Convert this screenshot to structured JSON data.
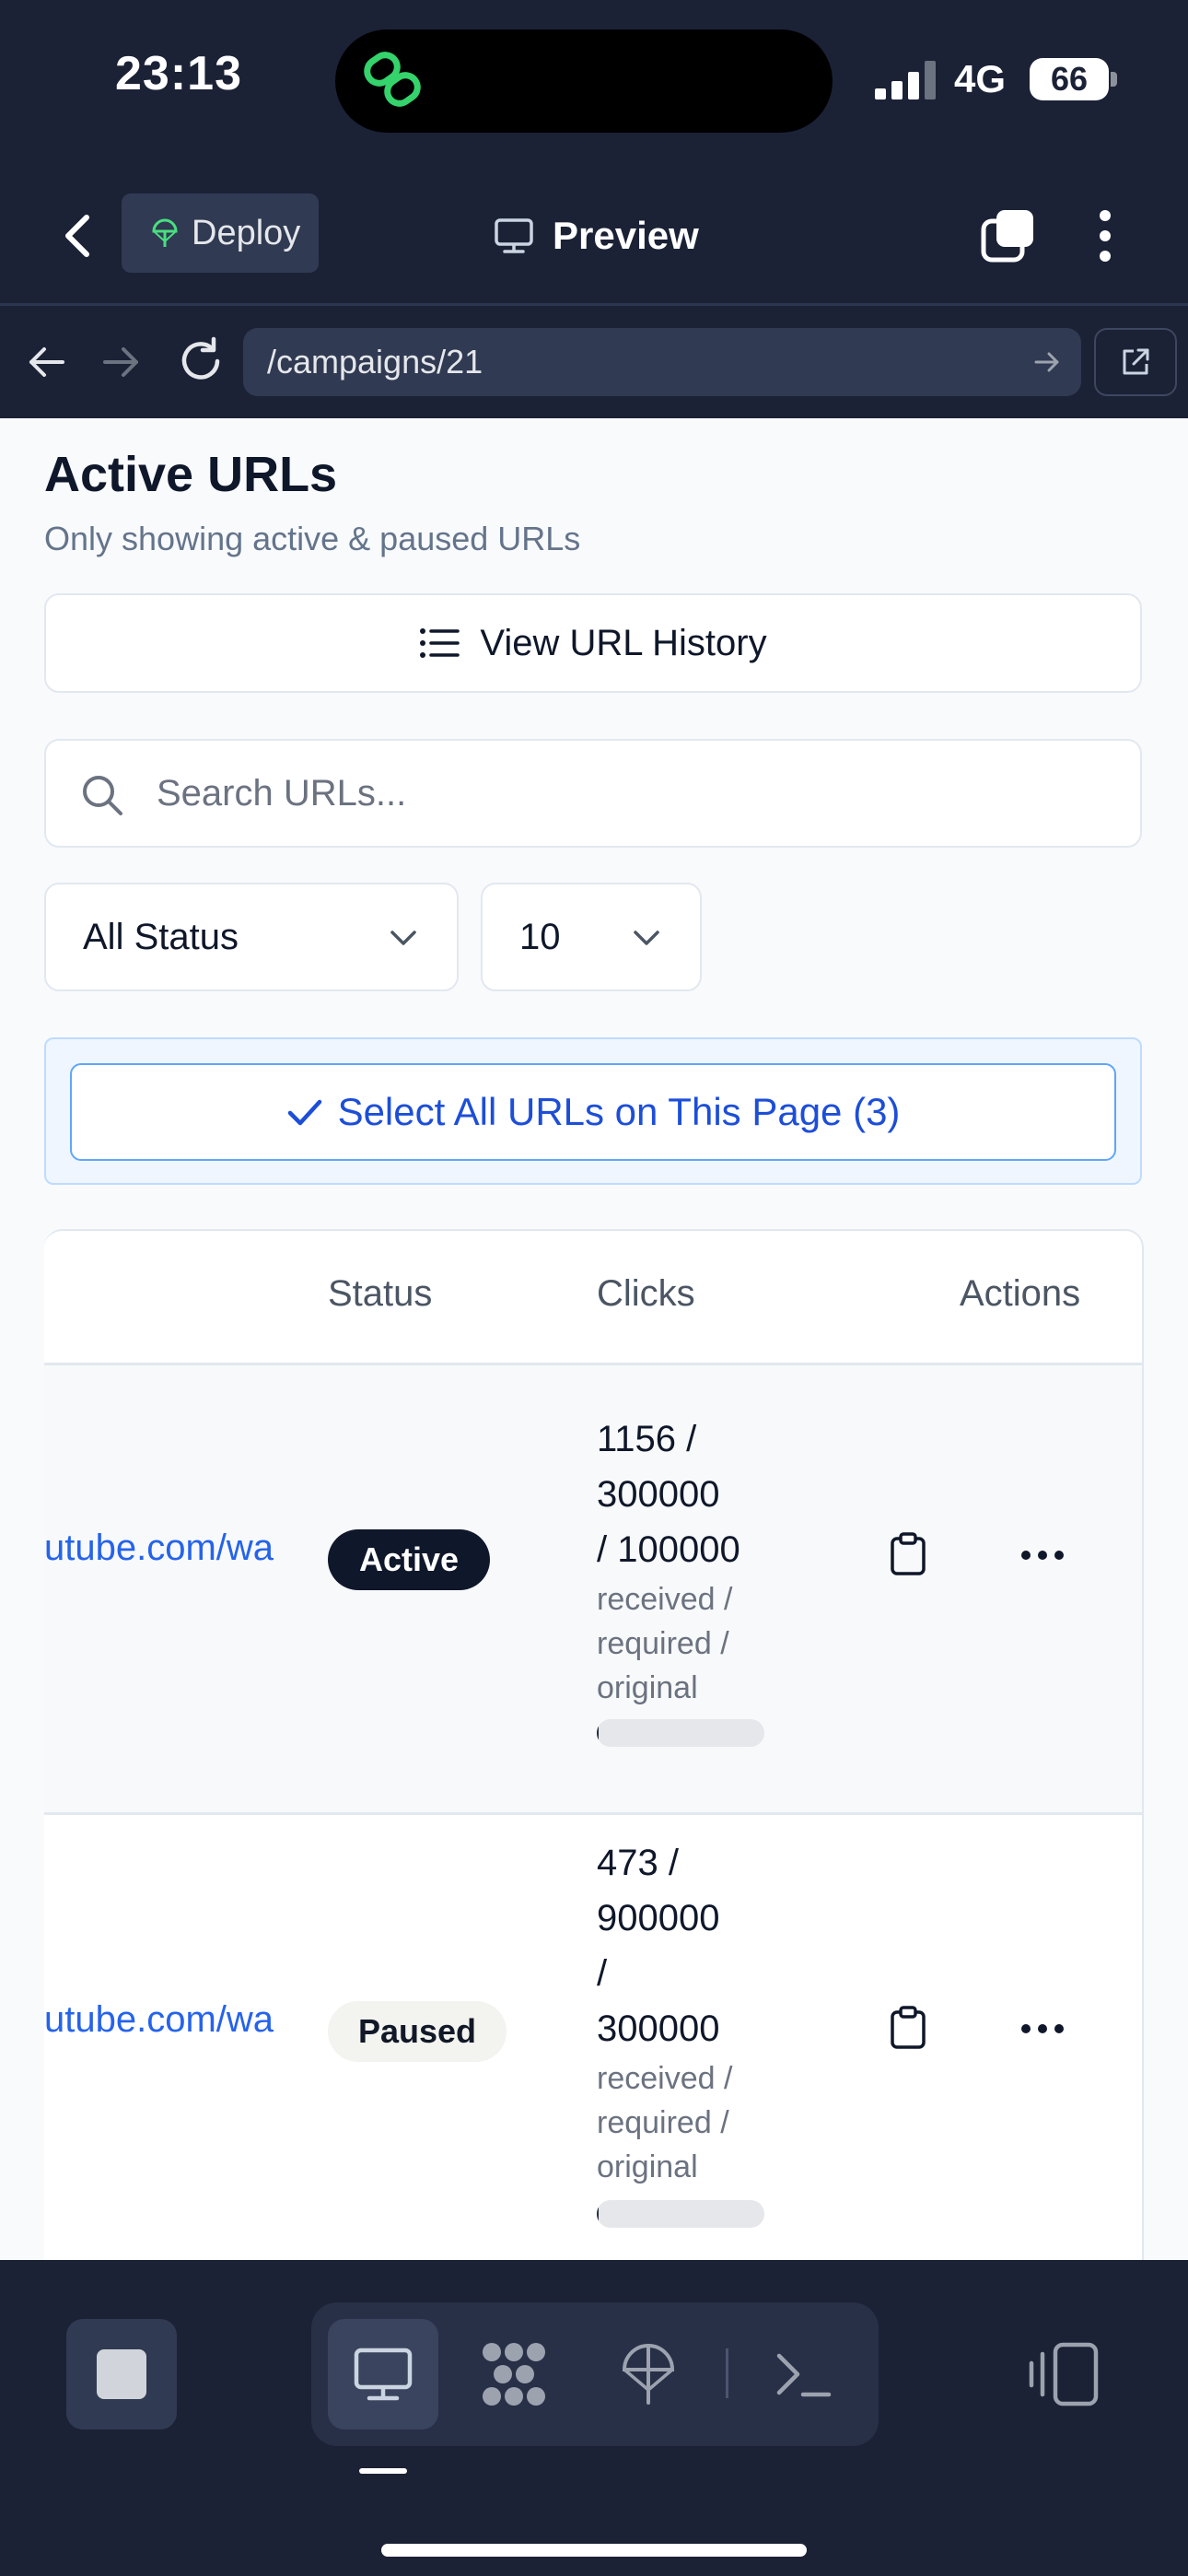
{
  "status_bar": {
    "time": "23:13",
    "network": "4G",
    "battery": "66",
    "icons": [
      "chat-app-icon",
      "signal-bars-icon",
      "battery-icon"
    ]
  },
  "app_header": {
    "deploy_label": "Deploy",
    "preview_label": "Preview",
    "icons": [
      "back-icon",
      "deploy-icon",
      "monitor-icon",
      "tabs-icon",
      "more-vertical-icon"
    ]
  },
  "url_bar": {
    "url": "/campaigns/21",
    "icons": [
      "back-arrow-icon",
      "forward-arrow-icon",
      "reload-icon",
      "go-arrow-icon",
      "external-link-icon"
    ]
  },
  "page": {
    "title": "Active URLs",
    "subtitle": "Only showing active & paused URLs",
    "history_button": "View URL History",
    "search_placeholder": "Search URLs...",
    "status_filter": "All Status",
    "page_size": "10",
    "select_all_button": "Select All URLs on This Page (3)"
  },
  "table": {
    "columns": [
      "Status",
      "Clicks",
      "Actions"
    ],
    "rows": [
      {
        "url": "utube.com/wa",
        "status": "Active",
        "clicks_lines": [
          "1156 /",
          "300000",
          "/ 100000"
        ],
        "caption_lines": [
          "received /",
          "required /",
          "original"
        ],
        "progress_fraction": 0.0039
      },
      {
        "url": "utube.com/wa",
        "status": "Paused",
        "clicks_lines": [
          "473 /",
          "900000",
          "/",
          "300000"
        ],
        "caption_lines": [
          "received /",
          "required /",
          "original"
        ],
        "progress_fraction": 0.0005
      }
    ]
  },
  "bottom_toolbar": {
    "icons": [
      "stop-icon",
      "monitor-icon",
      "apps-icon",
      "deploy-icon",
      "terminal-icon",
      "side-panel-icon"
    ]
  },
  "colors": {
    "chrome_bg": "#1b2236",
    "accent_blue": "#2563eb",
    "active_badge": "#0f172a"
  }
}
